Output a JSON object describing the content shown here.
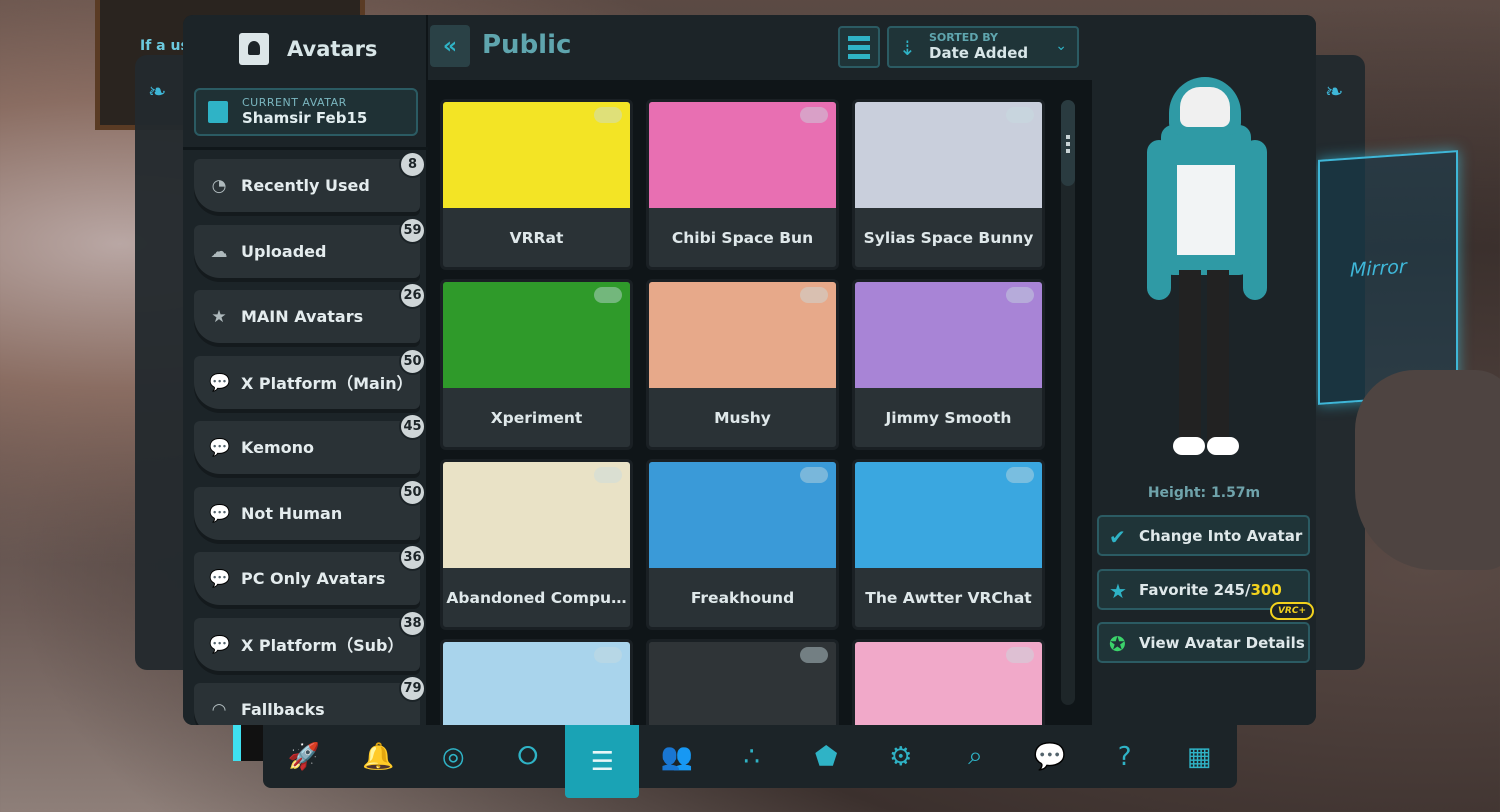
{
  "sidebar": {
    "title": "Avatars",
    "current_avatar": {
      "label": "CURRENT AVATAR",
      "value": "Shamsir Feb15"
    },
    "categories": [
      {
        "label": "Recently Used",
        "count": "8",
        "icon": "clock-icon"
      },
      {
        "label": "Uploaded",
        "count": "59",
        "icon": "cloud-upload-icon"
      },
      {
        "label": "MAIN Avatars",
        "count": "26",
        "icon": "star-icon"
      },
      {
        "label": "X Platform（Main）",
        "count": "50",
        "icon": "speech-bubble-icon"
      },
      {
        "label": "Kemono",
        "count": "45",
        "icon": "speech-bubble-icon"
      },
      {
        "label": "Not Human",
        "count": "50",
        "icon": "speech-bubble-icon"
      },
      {
        "label": "PC Only Avatars",
        "count": "36",
        "icon": "speech-bubble-icon"
      },
      {
        "label": "X Platform（Sub）",
        "count": "38",
        "icon": "speech-bubble-icon"
      },
      {
        "label": "Fallbacks",
        "count": "79",
        "icon": "fallback-icon"
      }
    ]
  },
  "header": {
    "title": "Public",
    "sort_label": "SORTED BY",
    "sort_value": "Date Added"
  },
  "avatars": [
    {
      "name": "VRRat",
      "color": "#f3e425"
    },
    {
      "name": "Chibi Space Bun",
      "color": "#e86fb2"
    },
    {
      "name": "Sylias Space Bunny",
      "color": "#c9cfdc"
    },
    {
      "name": "Xperiment",
      "color": "#2f9a2a"
    },
    {
      "name": "Mushy",
      "color": "#e7a98a"
    },
    {
      "name": "Jimmy Smooth",
      "color": "#a884d6"
    },
    {
      "name": "Abandoned Compu…",
      "color": "#e9e2c6"
    },
    {
      "name": "Freakhound",
      "color": "#3a9ad8"
    },
    {
      "name": "The Awtter VRChat",
      "color": "#3aa7e0"
    },
    {
      "name": "",
      "color": "#a9d4ec"
    },
    {
      "name": "",
      "color": "#2f3437"
    },
    {
      "name": "",
      "color": "#f1a9c9"
    }
  ],
  "preview": {
    "height": "Height: 1.57m",
    "change_label": "Change Into Avatar",
    "favorite_label": "Favorite 245/",
    "favorite_max": "300",
    "vrc_plus": "VRC+",
    "details_label": "View Avatar Details"
  },
  "background": {
    "mirror_label": "Mirror",
    "board_text": "If a us"
  },
  "nav": [
    {
      "icon": "rocket-icon",
      "glyph": "🚀"
    },
    {
      "icon": "bell-icon",
      "glyph": "🔔"
    },
    {
      "icon": "profile-icon",
      "glyph": "◎"
    },
    {
      "icon": "world-icon",
      "glyph": "⭘"
    },
    {
      "icon": "avatar-icon",
      "glyph": "☰"
    },
    {
      "icon": "social-icon",
      "glyph": "👥"
    },
    {
      "icon": "network-icon",
      "glyph": "∴"
    },
    {
      "icon": "safety-shield-icon",
      "glyph": "⬟"
    },
    {
      "icon": "settings-gear-icon",
      "glyph": "⚙"
    },
    {
      "icon": "search-icon",
      "glyph": "⌕"
    },
    {
      "icon": "chat-icon",
      "glyph": "💬"
    },
    {
      "icon": "help-icon",
      "glyph": "?"
    },
    {
      "icon": "gallery-icon",
      "glyph": "▦"
    }
  ],
  "active_nav": 4
}
